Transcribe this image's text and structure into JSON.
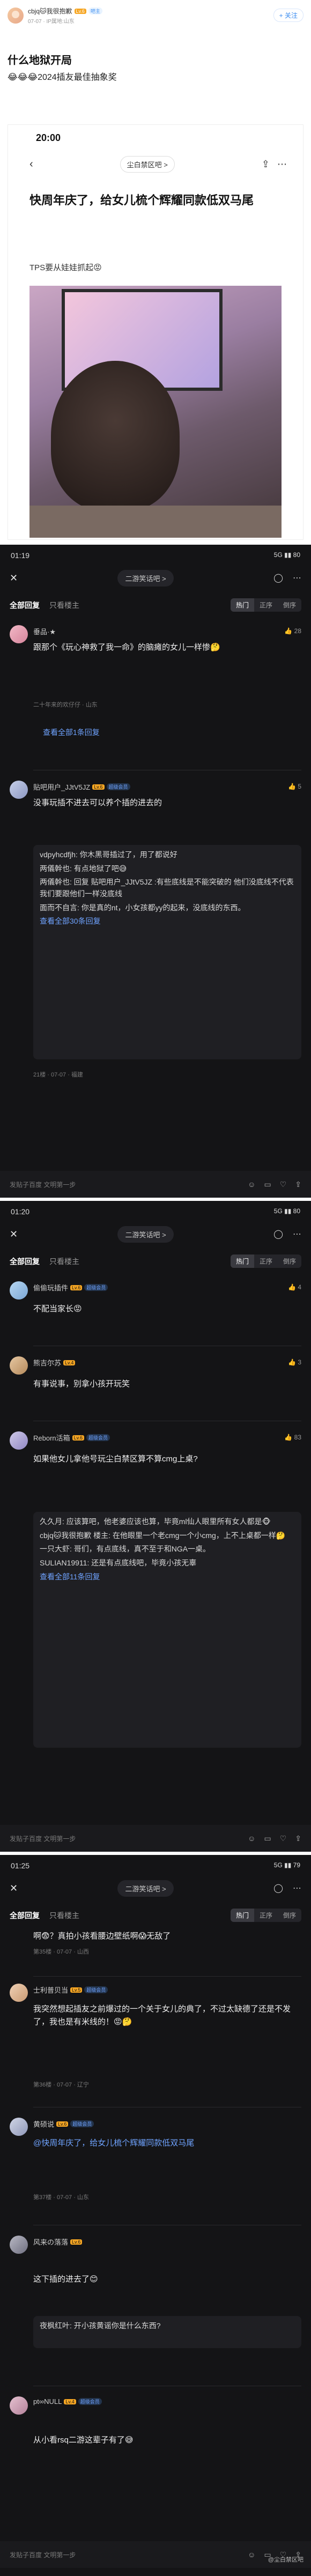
{
  "post": {
    "author_name": "cbjq🐱我很抱歉",
    "author_lv": "Lv.6",
    "author_badge": "吧主",
    "author_sub": "07-07 · IP属地:山东",
    "follow": "+ 关注",
    "title": "什么地狱开局",
    "line": "😂😂😂2024插友最佳抽象奖"
  },
  "screenshot": {
    "time": "20:00",
    "bar_name": "尘白禁区吧 >",
    "title": "快周年庆了，给女儿梳个辉耀同款低双马尾",
    "text": "TPS要从娃娃抓起😡"
  },
  "sec2": {
    "time": "01:19",
    "status_right": "5G ▮▮ 80",
    "bar_pill": "二游笑话吧 >",
    "tabs": [
      "全部回复",
      "只看楼主"
    ],
    "sort": [
      "热门",
      "正序",
      "倒序"
    ],
    "c1": {
      "name": "垂品·★",
      "likes": "28",
      "body": "跟那个《玩心神救了我一命》的脑瘫的女儿一样惨🤔",
      "meta": "二十年来的欢仔仔 · 山东",
      "more": "查看全部1条回复"
    },
    "c2": {
      "name": "贴吧用户_JJtV5JZ",
      "lv": "Lv.6",
      "vip": "超级会员",
      "likes": "5",
      "body": "没事玩插不进去可以养个插的进去的",
      "replies": [
        "vdpyhcdfjh: 你木黑哥插过了，用了都说好",
        "两儀幹也: 有点地狱了吧😅",
        "两儀幹也: 回复 贴吧用户_JJtV5JZ :有些底线是不能突破的 他们没底线不代表我们要跟他们一样没底线",
        "面而不自言: 你是真的nt，小女孩都yy的起来，没底线的东西。"
      ],
      "more": "查看全部30条回复",
      "meta": "21楼 · 07-07 · 福建"
    },
    "bottom_input": "发贴子百度 文明第一步"
  },
  "sec3": {
    "time": "01:20",
    "status_right": "5G ▮▮ 80",
    "bar_pill": "二游笑话吧 >",
    "tabs": [
      "全部回复",
      "只看楼主"
    ],
    "sort": [
      "热门",
      "正序",
      "倒序"
    ],
    "c1": {
      "name": "偷偷玩插件",
      "lv": "Lv.6",
      "vip": "超级会员",
      "likes": "4",
      "body": "不配当家长😡",
      "meta": ""
    },
    "c2": {
      "name": "熊吉尔苏",
      "lv": "Lv.4",
      "likes": "3",
      "body": "有事说事，别拿小孩开玩笑",
      "meta": ""
    },
    "c3": {
      "name": "Reborn活箱",
      "lv": "Lv.6",
      "vip": "超级会员",
      "likes": "83",
      "body": "如果他女儿拿他号玩尘白禁区算不算cmg上桌?",
      "replies": [
        "久久月: 应该算吧，他老婆应该也算，毕竟ml仙人眼里所有女人都是🐵",
        "cbjq🐱我很抱歉 楼主: 在他眼里一个老cmg一个小cmg，上不上桌都一样🤔",
        "一只大虾: 哥们，有点底线，真不至于和NGA一桌。",
        "SULIAN19911: 还是有点底线吧，毕竟小孩无辜"
      ],
      "more": "查看全部11条回复"
    },
    "bottom_input": "发贴子百度 文明第一步"
  },
  "sec4": {
    "time": "01:25",
    "status_right": "5G ▮▮ 79",
    "bar_pill": "二游笑话吧 >",
    "tabs": [
      "全部回复",
      "只看楼主"
    ],
    "sort": [
      "热门",
      "正序",
      "倒序"
    ],
    "c0_body": "啊😨？真拍小孩看腰边壁纸啊😱无敌了",
    "c0_meta": "第35楼 · 07-07 · 山西",
    "c1": {
      "name": "士利普贝当",
      "lv": "Lv.5",
      "vip": "超级会员",
      "body": "我突然想起插友之前爆过的一个关于女儿的典了，不过太缺德了还是不发了，我也是有米线的！😡🤔",
      "meta": "第36楼 · 07-07 · 辽宁"
    },
    "c2": {
      "name": "黄硕说",
      "lv": "Lv.6",
      "vip": "超级会员",
      "body": "@快周年庆了，给女儿梳个辉耀同款低双马尾",
      "meta": "第37楼 · 07-07 · 山东"
    },
    "c3": {
      "name": "风来の落落",
      "lv": "Lv.6",
      "body": "这下插的进去了😊",
      "reply": "夜枫红叶: 开小孩黄谣你是什么东西?",
      "meta": ""
    },
    "c4": {
      "name": "pt∞NULL",
      "lv": "Lv.4",
      "vip": "超级会员",
      "body": "从小看rsq二游这辈子有了😅",
      "meta": ""
    },
    "bottom_input": "发贴子百度 文明第一步",
    "watermark": "@尘白禁区吧"
  }
}
